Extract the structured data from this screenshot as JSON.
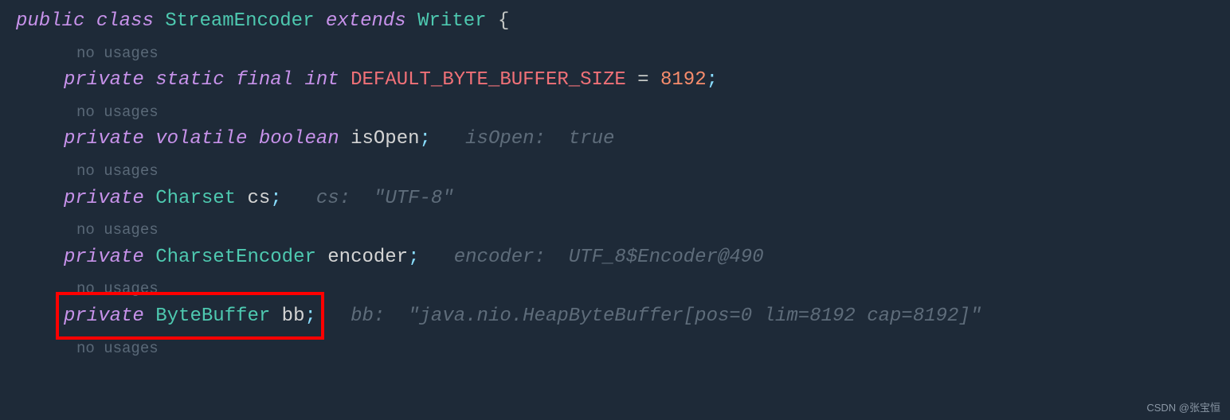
{
  "code": {
    "line1": {
      "kw_public": "public",
      "kw_class": "class",
      "class_name": "StreamEncoder",
      "kw_extends": "extends",
      "super_class": "Writer",
      "brace": "{"
    },
    "hint1": "no usages",
    "line2": {
      "kw_private": "private",
      "kw_static": "static",
      "kw_final": "final",
      "kw_int": "int",
      "constant_name": "DEFAULT_BYTE_BUFFER_SIZE",
      "eq": " = ",
      "value": "8192",
      "semi": ";"
    },
    "hint2": "no usages",
    "line3": {
      "kw_private": "private",
      "kw_volatile": "volatile",
      "kw_boolean": "boolean",
      "var_name": "isOpen",
      "semi": ";",
      "inline_hint": "isOpen:  true"
    },
    "hint3": "no usages",
    "line4": {
      "kw_private": "private",
      "type": "Charset",
      "var_name": "cs",
      "semi": ";",
      "inline_hint": "cs:  \"UTF-8\""
    },
    "hint4": "no usages",
    "line5": {
      "kw_private": "private",
      "type": "CharsetEncoder",
      "var_name": "encoder",
      "semi": ";",
      "inline_hint": "encoder:  UTF_8$Encoder@490"
    },
    "hint5": "no usages",
    "line6": {
      "kw_private": "private",
      "type": "ByteBuffer",
      "var_name": "bb",
      "semi": ";",
      "inline_hint": "bb:  \"java.nio.HeapByteBuffer[pos=0 lim=8192 cap=8192]\""
    },
    "hint6": "no usages"
  },
  "watermark": "CSDN @张宝恒"
}
